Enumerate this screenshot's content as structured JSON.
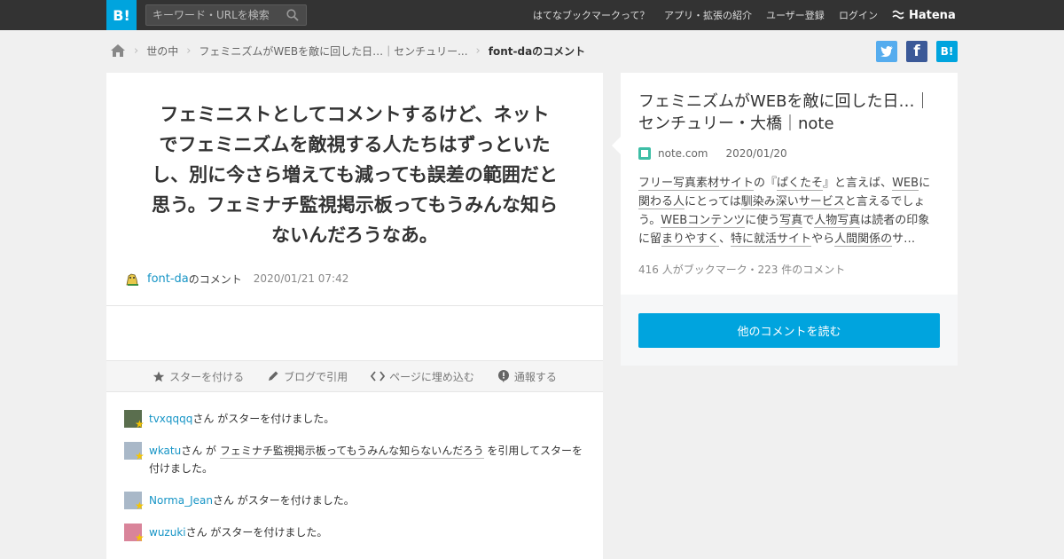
{
  "header": {
    "logo": "B!",
    "search_placeholder": "キーワード・URLを検索",
    "nav": [
      "はてなブックマークって？",
      "アプリ・拡張の紹介",
      "ユーザー登録",
      "ログイン"
    ],
    "brand": "Hatena"
  },
  "breadcrumb": {
    "items": [
      "世の中",
      "フェミニズムがWEBを敵に回した日…｜センチュリー..."
    ],
    "current": "font-daのコメント"
  },
  "social": {
    "facebook": "f",
    "bookmark": "B!"
  },
  "comment": {
    "lines": [
      "フェミニストとしてコメントするけど、ネット",
      "でフェミニズムを敵視する人たちはずっといた",
      "し、別に今さら増えても減っても誤差の範囲だと",
      "思う。フェミナチ監視掲示板ってもうみんな知ら",
      "ないんだろうなあ。"
    ],
    "author": "font-da",
    "author_suffix": "のコメント",
    "date": "2020/01/21 07:42"
  },
  "actions": {
    "star": "スターを付ける",
    "blog": "ブログで引用",
    "embed": "ページに埋め込む",
    "report": "通報する"
  },
  "stars": [
    {
      "user": "tvxqqqq",
      "text": "さん がスターを付けました。",
      "avatar_color": "#5a6e4e"
    },
    {
      "user": "wkatu",
      "pre": "さん が ",
      "quote": "フェミナチ監視掲示板ってもうみんな知らないんだろう",
      "post_line1": " を引用してスターを",
      "post_line2": "付けました。",
      "avatar_color": "#a9b8c8"
    },
    {
      "user": "Norma_Jean",
      "text": "さん がスターを付けました。",
      "avatar_color": "#a9b8c8"
    },
    {
      "user": "wuzuki",
      "text": "さん がスターを付けました。",
      "avatar_color": "#d9849a"
    }
  ],
  "article": {
    "title_line1": "フェミニズムがWEBを敵に回した日…｜",
    "title_line2": "センチュリー・大橋｜note",
    "site": "note.com",
    "date": "2020/01/20",
    "excerpt": {
      "l1a": "フリー写真素材サイト",
      "l1b": "の『",
      "l1c": "ぱくたそ",
      "l1d": "』と言えば、",
      "l1e": "WEB",
      "l1f": "に",
      "l2a": "関わる人",
      "l2b": "にとっては",
      "l2c": "馴染み深い",
      "l2d": "サービス",
      "l2e": "と言えるでしょ",
      "l3a": "う。",
      "l3b": "WEBコンテンツ",
      "l3c": "に使う",
      "l3d": "写真",
      "l3e": "で",
      "l3f": "人物写真",
      "l3g": "は読者の印象",
      "l4a": "に留",
      "l4b": "まりやすく",
      "l4c": "、",
      "l4d": "特に就活サイト",
      "l4e": "やら",
      "l4f": "人間関係の",
      "l4g": "サ…"
    },
    "bookmark_count": "416 人がブックマーク・223 件のコメント",
    "more_button": "他のコメントを読む"
  },
  "colors": {
    "accent": "#00a4de",
    "link": "#1795c6",
    "twitter": "#55acee",
    "facebook": "#3b5998"
  }
}
